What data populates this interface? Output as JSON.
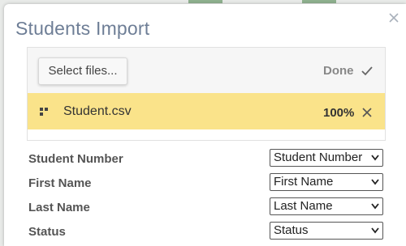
{
  "dialog": {
    "title": "Students Import"
  },
  "upload": {
    "select_label": "Select files...",
    "status_label": "Done",
    "file": {
      "name": "Student.csv",
      "progress_text": "100%",
      "progress": 1.0
    }
  },
  "mapping": [
    {
      "label": "Student Number",
      "value": "Student Number"
    },
    {
      "label": "First Name",
      "value": "First Name"
    },
    {
      "label": "Last Name",
      "value": "Last Name"
    },
    {
      "label": "Status",
      "value": "Status"
    }
  ],
  "colors": {
    "title": "#6e7e96",
    "file_row_bg": "#fae38a",
    "header_bg": "#f6f6f6"
  },
  "icons": {
    "close": "close-icon",
    "check": "check-icon",
    "grip": "grip-icon",
    "remove": "remove-icon",
    "dropdown": "chevron-down-icon"
  }
}
